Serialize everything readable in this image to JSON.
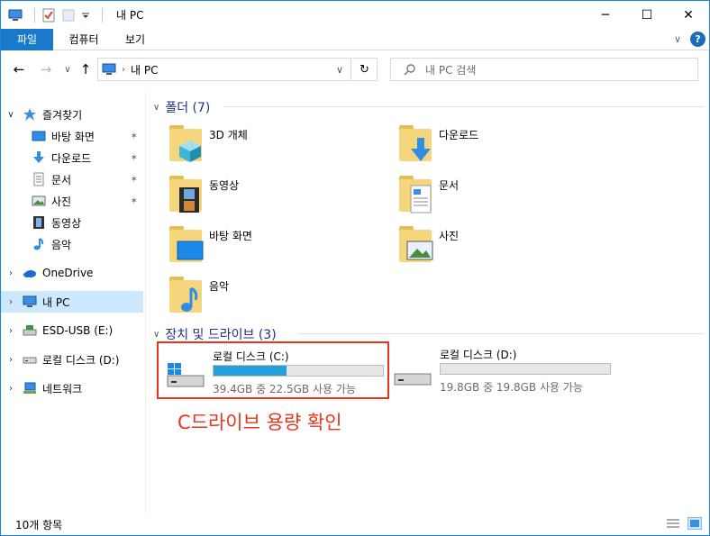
{
  "window": {
    "title": "내 PC"
  },
  "title_buttons": {
    "minimize": "─",
    "maximize": "☐",
    "close": "✕"
  },
  "ribbon": {
    "tabs": [
      "파일",
      "컴퓨터",
      "보기"
    ]
  },
  "address": {
    "path": "내 PC",
    "search_placeholder": "내 PC 검색"
  },
  "nav": {
    "quick_access": "즐겨찾기",
    "quick_items": [
      "바탕 화면",
      "다운로드",
      "문서",
      "사진",
      "동영상",
      "음악"
    ],
    "onedrive": "OneDrive",
    "this_pc": "내 PC",
    "esd_usb": "ESD-USB (E:)",
    "local_disk": "로컬 디스크 (D:)",
    "network": "네트워크"
  },
  "folders_group": {
    "title": "폴더 (7)"
  },
  "folders": [
    "3D 개체",
    "다운로드",
    "동영상",
    "문서",
    "바탕 화면",
    "사진",
    "음악"
  ],
  "drives_group": {
    "title": "장치 및 드라이브 (3)"
  },
  "drives": [
    {
      "name": "로컬 디스크 (C:)",
      "free_text": "39.4GB 중 22.5GB 사용 가능",
      "used_fraction": 0.43
    },
    {
      "name": "로컬 디스크 (D:)",
      "free_text": "19.8GB 중 19.8GB 사용 가능",
      "used_fraction": 0.0
    }
  ],
  "annotation": "C드라이브 용량 확인",
  "status": {
    "items": "10개 항목"
  },
  "colors": {
    "accent": "#1979ca",
    "selection": "#cce8ff",
    "highlight": "#e8341c",
    "bar_fill": "#26a0da"
  }
}
